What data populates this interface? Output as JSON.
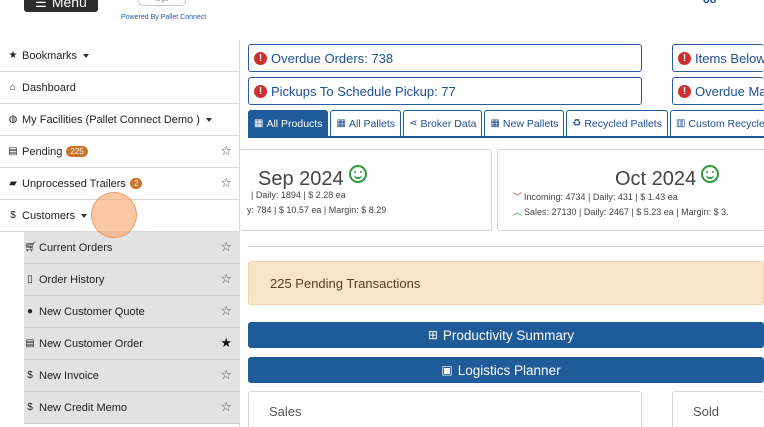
{
  "header": {
    "menu_label": "Menu",
    "menu_icon": "hamburger-icon",
    "logo_text": "logo",
    "powered_by": "Powered By Pallet Connect",
    "top_right_text": "oo"
  },
  "sidebar": {
    "items": [
      {
        "label": "Bookmarks",
        "icon": "star-icon"
      },
      {
        "label": "Dashboard",
        "icon": "home-icon"
      },
      {
        "label": "My Facilities (Pallet Connect Demo )",
        "icon": "globe-icon"
      },
      {
        "label": "Pending",
        "icon": "clipboard-icon",
        "badge": "225"
      },
      {
        "label": "Unprocessed Trailers",
        "icon": "truck-icon",
        "badge": "2"
      },
      {
        "label": "Customers",
        "icon": "dollar-icon"
      }
    ],
    "sub_items": [
      {
        "label": "Current Orders",
        "icon": "cart-icon"
      },
      {
        "label": "Order History",
        "icon": "file-icon"
      },
      {
        "label": "New Customer Quote",
        "icon": "comment-icon"
      },
      {
        "label": "New Customer Order",
        "icon": "list-icon"
      },
      {
        "label": "New Invoice",
        "icon": "dollar-icon"
      },
      {
        "label": "New Credit Memo",
        "icon": "dollar-icon"
      }
    ]
  },
  "alerts": {
    "overdue_orders": "Overdue Orders: 738",
    "pickups": "Pickups To Schedule Pickup: 77",
    "items_below": "Items Below",
    "overdue_ma": "Overdue Ma"
  },
  "tabs": [
    {
      "label": "All Products",
      "icon": "boxes-icon",
      "active": true
    },
    {
      "label": "All Pallets",
      "icon": "boxes-icon",
      "active": false
    },
    {
      "label": "Broker Data",
      "icon": "share-icon",
      "active": false
    },
    {
      "label": "New Pallets",
      "icon": "boxes-icon",
      "active": false
    },
    {
      "label": "Recycled Pallets",
      "icon": "recycle-icon",
      "active": false
    },
    {
      "label": "Custom Recycle",
      "icon": "chart-icon",
      "active": false
    }
  ],
  "month_cards": [
    {
      "title": "Sep 2024",
      "line1": "| Daily: 1894 | $ 2.28 ea",
      "line2": "y: 784 | $ 10.57 ea | Margin: $ 8.29"
    },
    {
      "title": "Oct 2024",
      "line1": "Incoming: 4734 | Daily: 431 | $ 1.43 ea",
      "line2": "Sales: 27130 | Daily: 2467 | $ 5.23 ea | Margin: $ 3."
    }
  ],
  "pending_text": "225 Pending Transactions",
  "buttons": {
    "productivity": "Productivity Summary",
    "logistics": "Logistics Planner"
  },
  "panels": {
    "sales": "Sales",
    "sold": "Sold"
  },
  "colors": {
    "primary": "#1f5a99",
    "alert_red": "#cf2e2e",
    "badge_orange": "#c9762c",
    "pending_bg": "#f8e5c8",
    "smile_green": "#2e9a3f"
  }
}
